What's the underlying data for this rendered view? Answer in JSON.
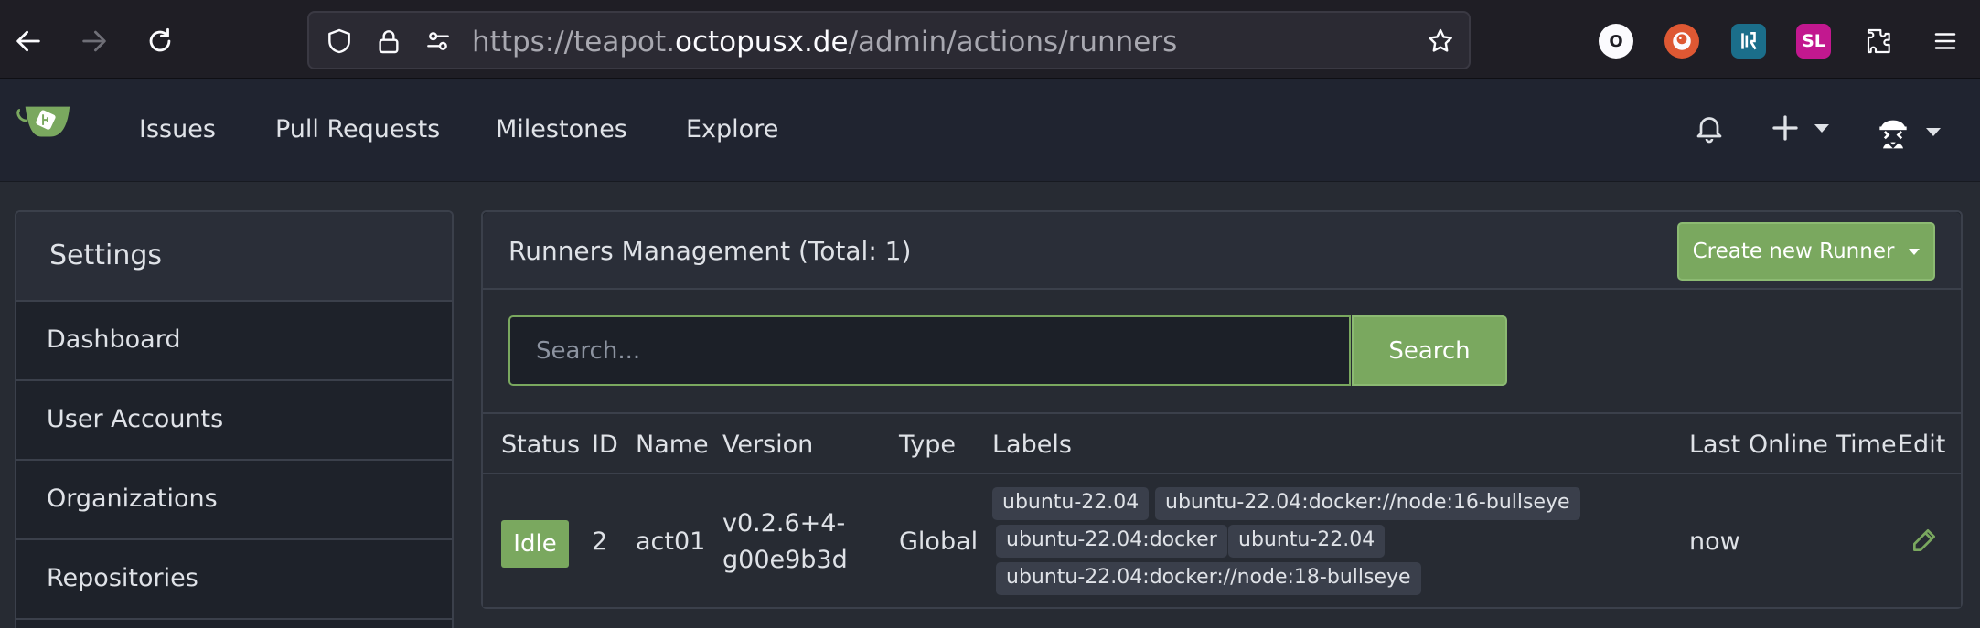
{
  "browser": {
    "url_scheme": "https://teapot.",
    "url_host": "octopusx.de",
    "url_path": "/admin/actions/runners"
  },
  "extensions": [
    "obsidian-web-clipper-icon",
    "duckduckgo-icon",
    "kasm-icon",
    "simplelogin-icon",
    "extensions-icon",
    "menu-icon"
  ],
  "extension_labels": {
    "sl": "SL",
    "o": "O"
  },
  "navbar": {
    "items": [
      {
        "label": "Issues"
      },
      {
        "label": "Pull Requests"
      },
      {
        "label": "Milestones"
      },
      {
        "label": "Explore"
      }
    ]
  },
  "sidebar": {
    "title": "Settings",
    "items": [
      {
        "label": "Dashboard"
      },
      {
        "label": "User Accounts"
      },
      {
        "label": "Organizations"
      },
      {
        "label": "Repositories"
      }
    ]
  },
  "panel": {
    "title": "Runners Management (Total: 1)",
    "create_label": "Create new Runner",
    "search_placeholder": "Search...",
    "search_label": "Search"
  },
  "table": {
    "headers": [
      "Status",
      "ID",
      "Name",
      "Version",
      "Type",
      "Labels",
      "Last Online Time",
      "Edit"
    ],
    "rows": [
      {
        "status": "Idle",
        "id": "2",
        "name": "act01",
        "version_line1": "v0.2.6+4-",
        "version_line2": "g00e9b3d",
        "type": "Global",
        "labels": [
          "ubuntu-22.04",
          "ubuntu-22.04:docker://node:16-bullseye",
          "ubuntu-22.04:docker",
          "ubuntu-22.04",
          "ubuntu-22.04:docker://node:18-bullseye"
        ],
        "last_online": "now"
      }
    ]
  },
  "colors": {
    "accent": "#7aa85f",
    "background": "#272b33",
    "navbar": "#202430"
  }
}
